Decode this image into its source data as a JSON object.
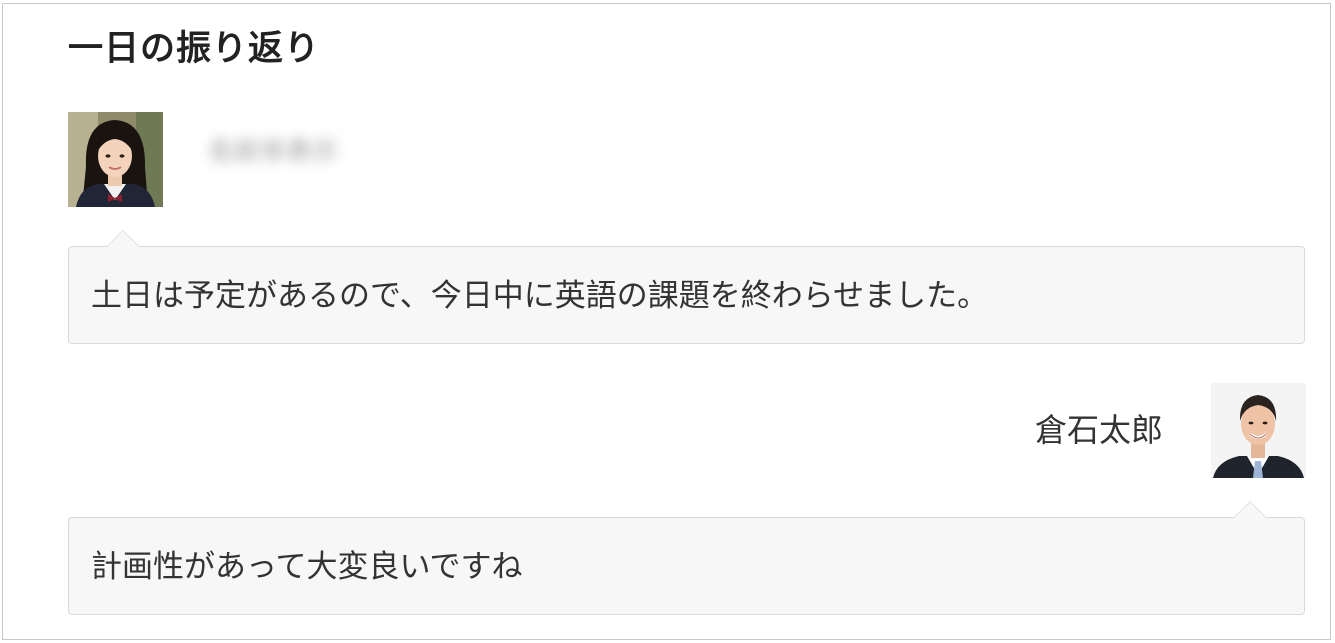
{
  "section": {
    "title": "一日の振り返り"
  },
  "student": {
    "avatar_icon": "student-avatar-photo",
    "name_blurred": "名前非表示",
    "message": "土日は予定があるので、今日中に英語の課題を終わらせました。"
  },
  "teacher": {
    "avatar_icon": "teacher-avatar-photo",
    "name": "倉石太郎",
    "message": "計画性があって大変良いですね"
  },
  "colors": {
    "bubble_bg": "#f7f7f7",
    "bubble_border": "#d9d9d9",
    "frame_border": "#c8c8c8",
    "text": "#333333"
  }
}
